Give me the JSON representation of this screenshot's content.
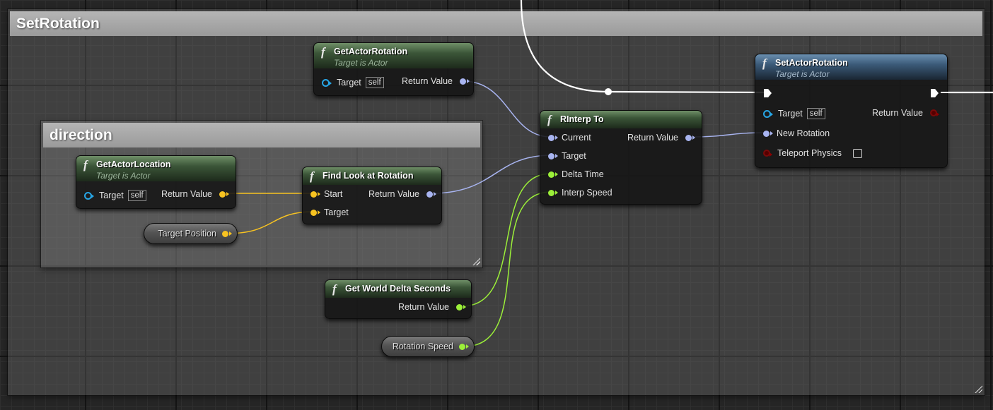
{
  "comments": {
    "set_rotation": {
      "title": "SetRotation"
    },
    "direction": {
      "title": "direction"
    }
  },
  "nodes": {
    "get_actor_rotation": {
      "title": "GetActorRotation",
      "subtitle": "Target is Actor",
      "target_label": "Target",
      "self_label": "self",
      "return_label": "Return Value"
    },
    "get_actor_location": {
      "title": "GetActorLocation",
      "subtitle": "Target is Actor",
      "target_label": "Target",
      "self_label": "self",
      "return_label": "Return Value"
    },
    "find_look_at_rotation": {
      "title": "Find Look at Rotation",
      "start_label": "Start",
      "target_label": "Target",
      "return_label": "Return Value"
    },
    "rinterp_to": {
      "title": "RInterp To",
      "current_label": "Current",
      "target_label": "Target",
      "delta_time_label": "Delta Time",
      "interp_speed_label": "Interp Speed",
      "return_label": "Return Value"
    },
    "set_actor_rotation": {
      "title": "SetActorRotation",
      "subtitle": "Target is Actor",
      "target_label": "Target",
      "self_label": "self",
      "new_rotation_label": "New Rotation",
      "teleport_label": "Teleport Physics",
      "return_label": "Return Value"
    },
    "get_world_delta_seconds": {
      "title": "Get World Delta Seconds",
      "return_label": "Return Value"
    },
    "target_position": {
      "label": "Target Position"
    },
    "rotation_speed": {
      "label": "Rotation Speed"
    }
  },
  "pin_colors": {
    "vector": "#f8c321",
    "float": "#9cf039",
    "rotator": "#a8b4f0",
    "object": "#27a6e6",
    "bool": "#8a0000",
    "exec": "#ffffff"
  },
  "icons": {
    "function": "f"
  }
}
